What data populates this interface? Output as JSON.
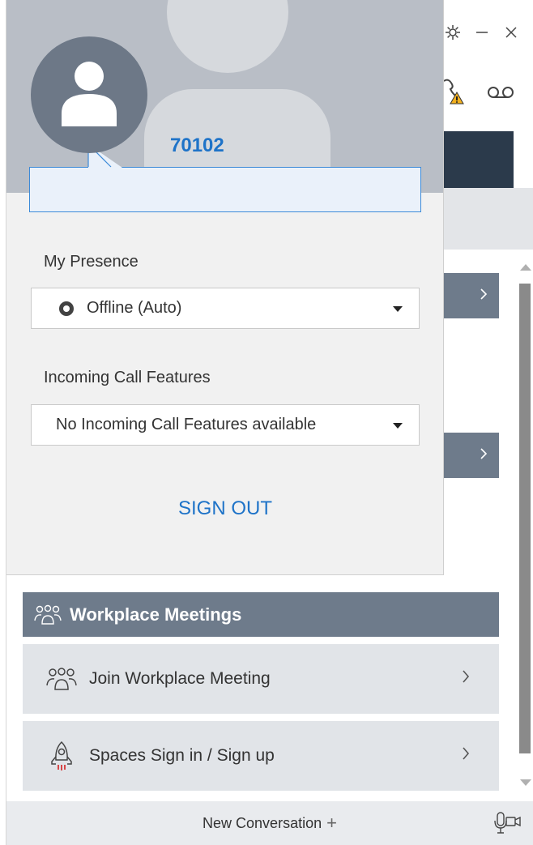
{
  "popup": {
    "extension": "70102",
    "presence_label": "My Presence",
    "presence_value": "Offline (Auto)",
    "call_features_label": "Incoming Call Features",
    "call_features_value": "No Incoming Call Features available",
    "sign_out_label": "SIGN OUT"
  },
  "meetings": {
    "header": "Workplace Meetings",
    "items": [
      {
        "label": "Join Workplace Meeting",
        "icon": "people-group-icon"
      },
      {
        "label": "Spaces Sign in / Sign up",
        "icon": "rocket-icon"
      }
    ]
  },
  "footer": {
    "new_conversation_label": "New Conversation",
    "plus_label": "+"
  },
  "colors": {
    "accent_blue": "#1e73c8",
    "section_header": "#6e7b8b",
    "menu_row": "#e1e4e8",
    "dark_strip": "#2b3a4b"
  }
}
